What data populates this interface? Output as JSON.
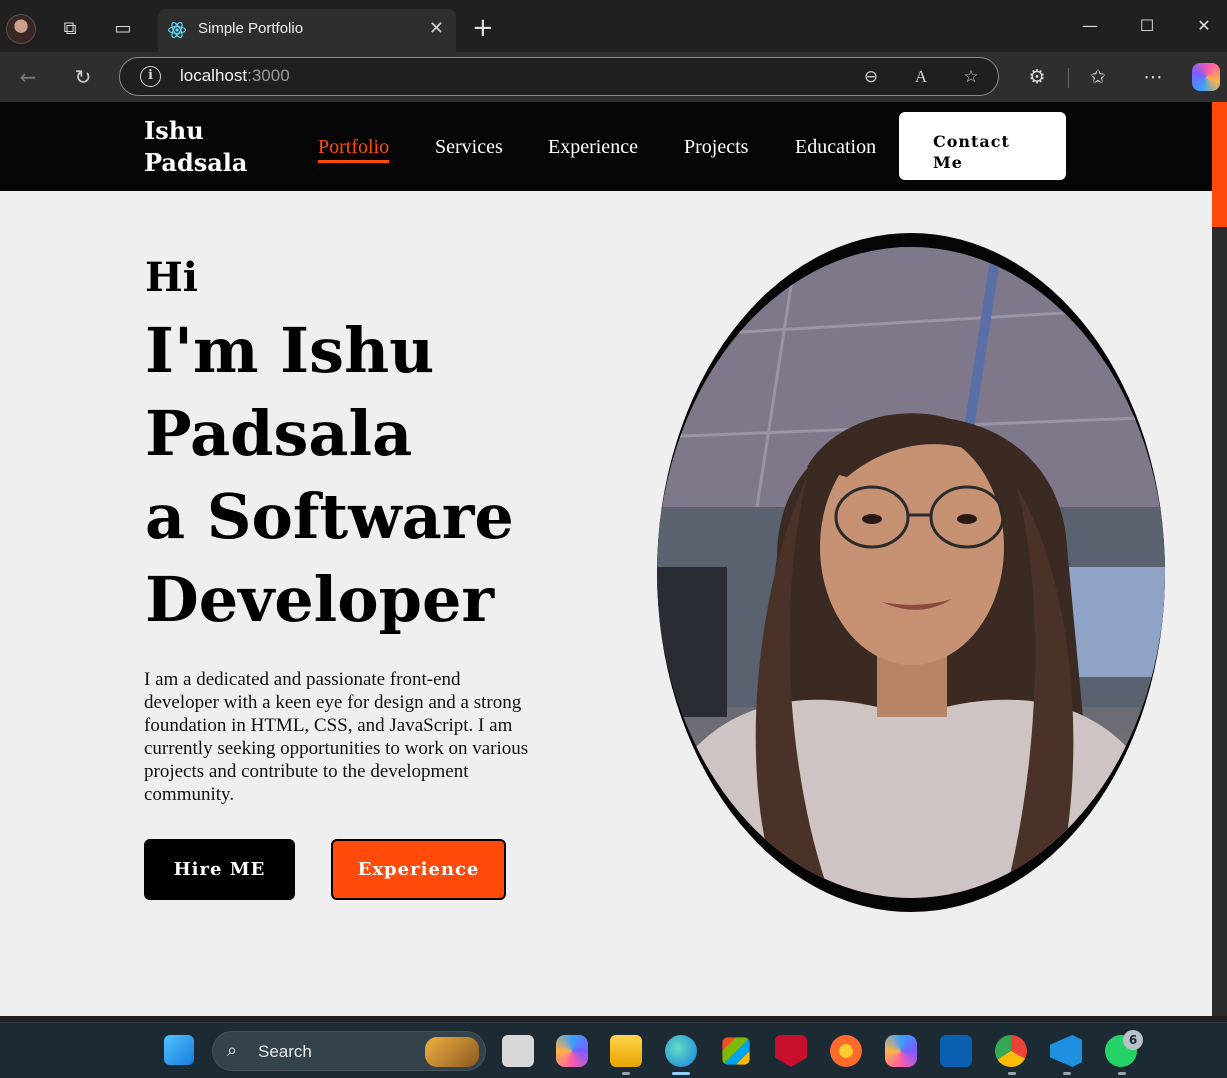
{
  "browser": {
    "tab_title": "Simple Portfolio",
    "tab_close": "✕",
    "new_tab": "+",
    "address_host": "localhost",
    "address_port": ":3000",
    "window_controls": {
      "minimize": "—",
      "maximize": "☐",
      "close": "✕"
    },
    "toolbar_icons": [
      "zoom-out-icon",
      "read-aloud-icon",
      "favorite-star-icon",
      "extensions-icon",
      "favorites-icon",
      "more-icon",
      "copilot-icon"
    ]
  },
  "site": {
    "logo": "Ishu\nPadsala",
    "nav": [
      {
        "label": "Portfolio",
        "active": true
      },
      {
        "label": "Services"
      },
      {
        "label": "Experience"
      },
      {
        "label": "Projects"
      },
      {
        "label": "Education"
      }
    ],
    "contact_label": "Contact\nMe",
    "hero": {
      "greeting": "Hi",
      "headline": "I'm Ishu\nPadsala\na Software\nDeveloper",
      "bio": "I am a dedicated and passionate front-end developer with a keen eye for design and a strong foundation in HTML, CSS, and JavaScript. I am currently seeking opportunities to work on various projects and contribute to the development community.",
      "hire_label": "Hire ME",
      "experience_label": "Experience"
    },
    "colors": {
      "accent": "#ff4a0a",
      "nav_bg": "#050505",
      "page_bg": "#f0efef"
    }
  },
  "taskbar": {
    "search_label": "Search",
    "notification_count": "6"
  }
}
